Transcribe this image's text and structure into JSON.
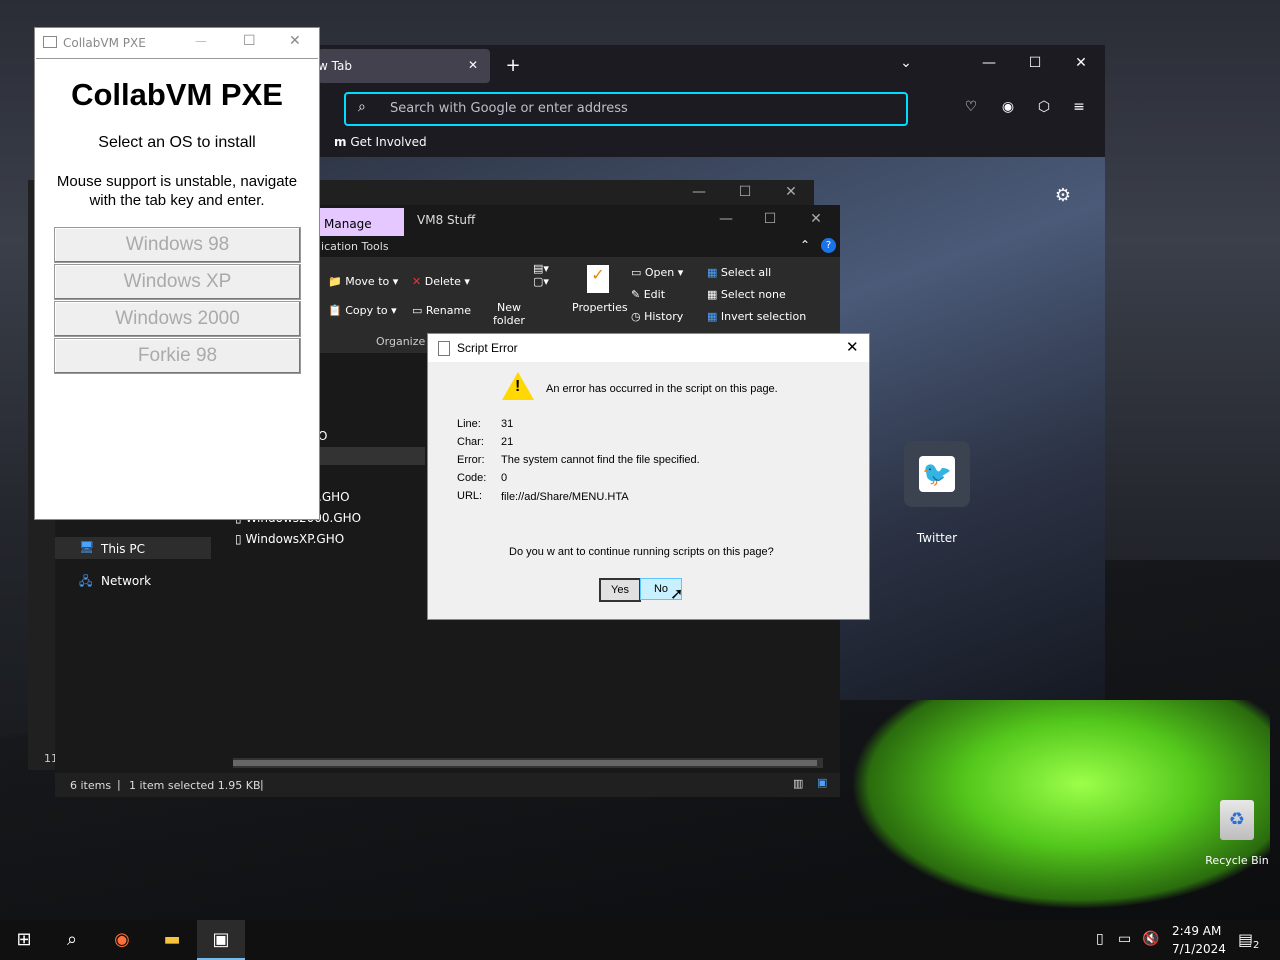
{
  "collabvm": {
    "window_title": "CollabVM PXE",
    "heading": "CollabVM PXE",
    "subtitle": "Select an OS to install",
    "hint": "Mouse support is unstable, navigate with the tab key and enter.",
    "options": [
      "Windows 98",
      "Windows XP",
      "Windows 2000",
      "Forkie 98"
    ]
  },
  "browser": {
    "tab_label": "w Tab",
    "address_placeholder": "Search with Google or enter address",
    "bookmark": "Get Involved",
    "shortcut_label": "Twitter"
  },
  "explorer": {
    "tab_manage": "Manage",
    "tab_folder": "VM8 Stuff",
    "app_tools": "lication Tools",
    "ribbon": {
      "move_to": "Move to",
      "copy_to": "Copy to",
      "delete": "Delete",
      "rename": "Rename",
      "new_folder_line1": "New",
      "new_folder_line2": "folder",
      "properties": "Properties",
      "open": "Open",
      "edit": "Edit",
      "history": "History",
      "select_all": "Select all",
      "select_none": "Select none",
      "invert_selection": "Invert selection",
      "group_organize": "Organize"
    },
    "files": [
      ".GHO",
      "Windows2000.GHO",
      "WindowsXP.GHO"
    ],
    "partial_text": "O",
    "nav": [
      "This PC",
      "Network"
    ],
    "status_items": "6 items",
    "status_selected": "1 item selected  1.95 KB",
    "back_window_count": "11"
  },
  "dialog": {
    "title": "Script Error",
    "message": "An error has occurred in the script on this page.",
    "fields": [
      {
        "label": "Line:",
        "value": "31"
      },
      {
        "label": "Char:",
        "value": "21"
      },
      {
        "label": "Error:",
        "value": "The system cannot find the file specified."
      },
      {
        "label": "Code:",
        "value": "0"
      },
      {
        "label": "URL:",
        "value": "file://ad/Share/MENU.HTA"
      }
    ],
    "question": "Do you w ant to continue running scripts on this page?",
    "yes": "Yes",
    "no": "No"
  },
  "desktop": {
    "recycle_bin": "Recycle Bin"
  },
  "taskbar": {
    "time": "2:49 AM",
    "date": "7/1/2024",
    "notification_count": "2"
  }
}
